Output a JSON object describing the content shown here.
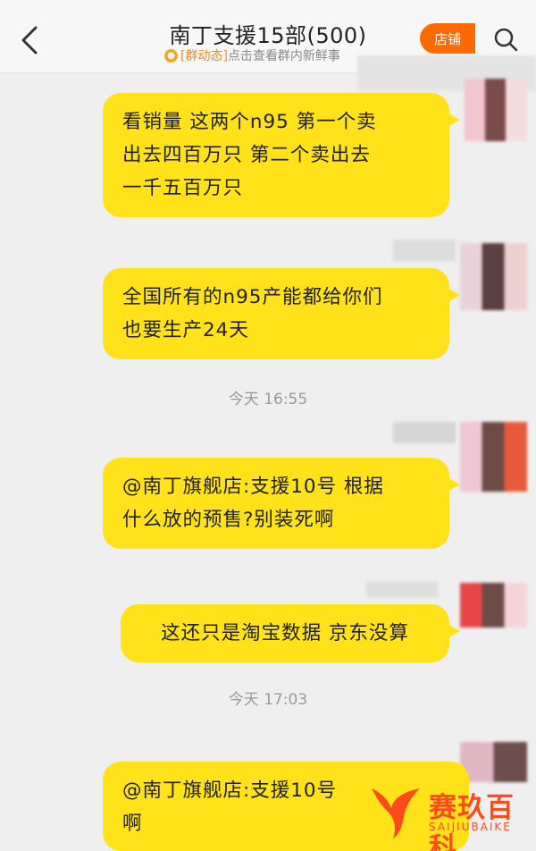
{
  "header": {
    "title": "南丁支援15部(500)",
    "subtitle_tag": "[群动态]",
    "subtitle_text": "点击查看群内新鲜事",
    "store_label": "店铺"
  },
  "messages": [
    {
      "lines": [
        "看销量 这两个n95 第一个卖",
        "出去四百万只 第二个卖出去",
        "一千五百万只"
      ]
    },
    {
      "lines": [
        "全国所有的n95产能都给你们",
        "也要生产24天"
      ]
    },
    {
      "lines": [
        "@南丁旗舰店:支援10号 根据",
        "什么放的预售?别装死啊"
      ]
    },
    {
      "lines": [
        "这还只是淘宝数据 京东没算"
      ]
    },
    {
      "lines": [
        "@南丁旗舰店:支援10号",
        "啊"
      ]
    }
  ],
  "timestamps": [
    "今天 16:55",
    "今天 17:03"
  ],
  "watermark": {
    "title": "赛玖百科",
    "subtitle": "SAIJIUBAIKE"
  },
  "colors": {
    "bubble": "#ffe21a",
    "accent": "#ff6a00",
    "background": "#efefef"
  }
}
